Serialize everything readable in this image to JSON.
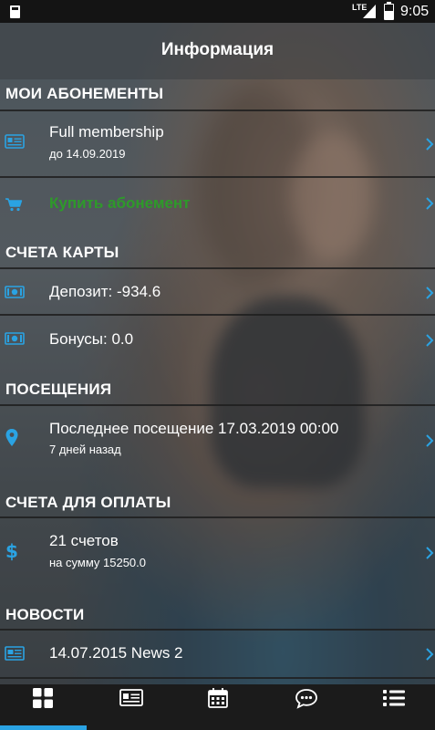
{
  "status_bar": {
    "network": "LTE",
    "time": "9:05"
  },
  "header": {
    "title": "Информация"
  },
  "sections": {
    "memberships": {
      "title": "МОИ АБОНЕМЕНТЫ",
      "items": [
        {
          "title": "Full membership",
          "subtitle": "до 14.09.2019",
          "icon": "id-card-icon"
        },
        {
          "title": "Купить абонемент",
          "icon": "cart-icon",
          "title_color": "#2e9a2a"
        }
      ]
    },
    "accounts": {
      "title": "СЧЕТА КАРТЫ",
      "items": [
        {
          "title": "Депозит: -934.6",
          "icon": "money-icon"
        },
        {
          "title": "Бонусы: 0.0",
          "icon": "money-icon"
        }
      ]
    },
    "visits": {
      "title": "ПОСЕЩЕНИЯ",
      "items": [
        {
          "title": "Последнее посещение 17.03.2019 00:00",
          "subtitle": "7 дней назад",
          "icon": "location-pin-icon"
        }
      ]
    },
    "invoices": {
      "title": "СЧЕТА ДЛЯ ОПЛАТЫ",
      "items": [
        {
          "title": "21 счетов",
          "subtitle": "на сумму 15250.0",
          "icon": "dollar-icon"
        }
      ]
    },
    "news": {
      "title": "НОВОСТИ",
      "items": [
        {
          "title": "14.07.2015 News 2",
          "icon": "newspaper-icon"
        }
      ]
    }
  },
  "tabs": [
    {
      "icon": "dashboard-grid-icon",
      "active": true
    },
    {
      "icon": "id-card-icon",
      "active": false
    },
    {
      "icon": "calendar-icon",
      "active": false
    },
    {
      "icon": "chat-bubble-icon",
      "active": false
    },
    {
      "icon": "list-icon",
      "active": false
    }
  ],
  "colors": {
    "accent": "#2aa3e3",
    "buy_green": "#2e9a2a",
    "tabbar": "#1b1b1b",
    "statusbar": "#141414"
  }
}
